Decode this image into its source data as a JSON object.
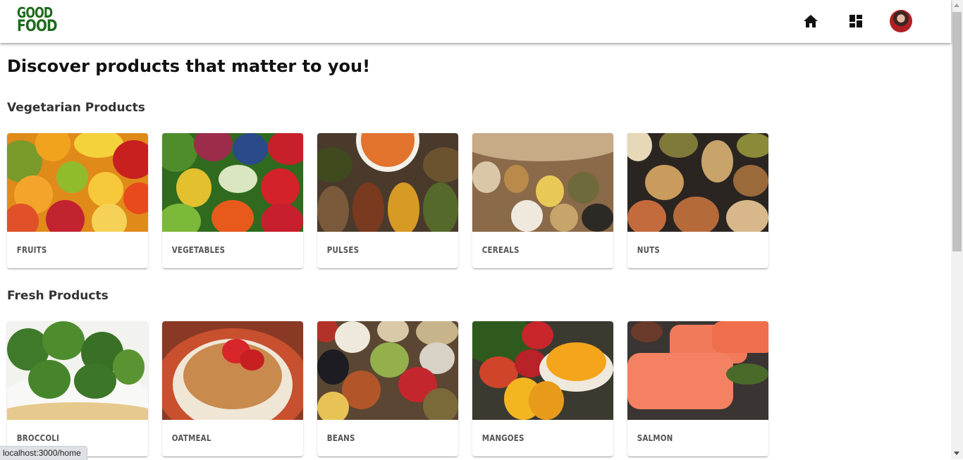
{
  "header": {
    "logo_line1": "GOOD",
    "logo_line2": "FOOD",
    "icons": [
      "home-icon",
      "dashboard-icon",
      "avatar"
    ]
  },
  "page_title": "Discover products that matter to you!",
  "sections": [
    {
      "title": "Vegetarian Products",
      "items": [
        {
          "label": "FRUITS"
        },
        {
          "label": "VEGETABLES"
        },
        {
          "label": "PULSES"
        },
        {
          "label": "CEREALS"
        },
        {
          "label": "NUTS"
        }
      ]
    },
    {
      "title": "Fresh Products",
      "items": [
        {
          "label": "BROCCOLI"
        },
        {
          "label": "OATMEAL"
        },
        {
          "label": "BEANS"
        },
        {
          "label": "MANGOES"
        },
        {
          "label": "SALMON"
        }
      ]
    }
  ],
  "status_bar": "localhost:3000/home",
  "colors": {
    "brand": "#1d6b1b",
    "text": "#111111"
  }
}
